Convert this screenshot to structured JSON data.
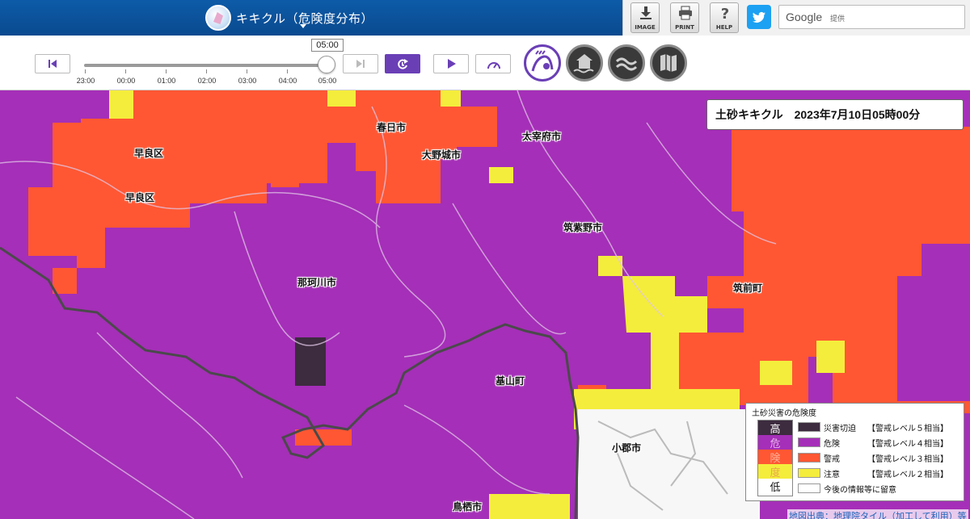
{
  "header": {
    "app_title": "キキクル（危険度分布）",
    "buttons": [
      {
        "label": "IMAGE",
        "icon": "download-icon"
      },
      {
        "label": "PRINT",
        "icon": "printer-icon"
      },
      {
        "label": "HELP",
        "icon": "help-icon"
      }
    ],
    "twitter_icon": "twitter-icon",
    "search": {
      "brand": "Google",
      "sub": "提供"
    }
  },
  "controls": {
    "current_time": "05:00",
    "time_labels": [
      "23:00",
      "00:00",
      "01:00",
      "02:00",
      "03:00",
      "04:00",
      "05:00"
    ],
    "slider_position_fraction": 1.0
  },
  "map": {
    "info_title": "土砂キキクル　2023年7月10日05時00分",
    "places": [
      {
        "name": "早良区",
        "id": "sawara-1"
      },
      {
        "name": "早良区",
        "id": "sawara-2"
      },
      {
        "name": "春日市",
        "id": "kasuga"
      },
      {
        "name": "大野城市",
        "id": "onojo"
      },
      {
        "name": "太宰府市",
        "id": "dazaifu"
      },
      {
        "name": "筑紫野市",
        "id": "chikushino"
      },
      {
        "name": "那珂川市",
        "id": "nakagawa"
      },
      {
        "name": "筑前町",
        "id": "chikuzen"
      },
      {
        "name": "基山町",
        "id": "kiyama"
      },
      {
        "name": "小郡市",
        "id": "ogori"
      },
      {
        "name": "鳥栖市",
        "id": "tosu"
      }
    ]
  },
  "legend": {
    "title": "土砂災害の危険度",
    "scale_high": "高",
    "scale_low": "低",
    "scale_mid": [
      "危",
      "険",
      "度"
    ],
    "items": [
      {
        "name": "災害切迫",
        "level": "【警戒レベル５相当】",
        "color": "#3d2b3f"
      },
      {
        "name": "危険",
        "level": "【警戒レベル４相当】",
        "color": "#a52fb8"
      },
      {
        "name": "警戒",
        "level": "【警戒レベル３相当】",
        "color": "#ff5733"
      },
      {
        "name": "注意",
        "level": "【警戒レベル２相当】",
        "color": "#f4ed3c"
      },
      {
        "name": "今後の情報等に留意",
        "level": "",
        "color": "#ffffff"
      }
    ]
  },
  "attribution": "地図出典：地理院タイル（加工して利用）等",
  "colors": {
    "purple": "#a52fb8",
    "orange": "#ff5733",
    "yellow": "#f4ed3c",
    "dark": "#3d2b3f",
    "accent": "#6a3fb6",
    "header": "#0d5ba8"
  }
}
